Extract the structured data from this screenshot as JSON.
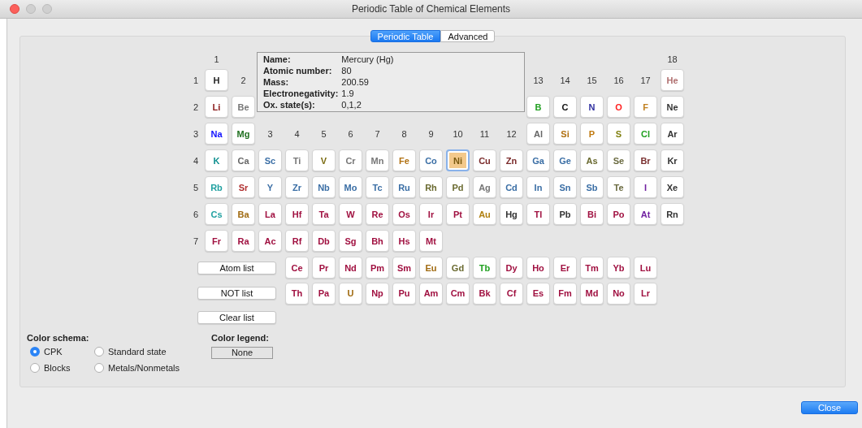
{
  "window": {
    "title": "Periodic Table of Chemical Elements"
  },
  "tabs": [
    {
      "label": "Periodic Table",
      "selected": true
    },
    {
      "label": "Advanced",
      "selected": false
    }
  ],
  "group_labels": [
    "1",
    "2",
    "3",
    "4",
    "5",
    "6",
    "7",
    "8",
    "9",
    "10",
    "11",
    "12",
    "13",
    "14",
    "15",
    "16",
    "17",
    "18"
  ],
  "info": [
    {
      "label": "Name:",
      "value": "Mercury (Hg)"
    },
    {
      "label": "Atomic number:",
      "value": "80"
    },
    {
      "label": "Mass:",
      "value": "200.59"
    },
    {
      "label": "Electronegativity:",
      "value": "1.9"
    },
    {
      "label": "Ox. state(s):",
      "value": "0,1,2"
    }
  ],
  "periods": [
    {
      "label": "1",
      "elements": [
        {
          "symbol": "H",
          "color": "#222222",
          "selected": false
        },
        {
          "symbol": "He",
          "color": "#b07070",
          "selected": false
        }
      ]
    },
    {
      "label": "2",
      "elements": [
        {
          "symbol": "Li",
          "color": "#8b1a1a",
          "selected": false
        },
        {
          "symbol": "Be",
          "color": "#777777",
          "selected": false
        },
        {
          "symbol": "B",
          "color": "#22a022",
          "selected": false
        },
        {
          "symbol": "C",
          "color": "#111111",
          "selected": false
        },
        {
          "symbol": "N",
          "color": "#3030a0",
          "selected": false
        },
        {
          "symbol": "O",
          "color": "#ff2020",
          "selected": false
        },
        {
          "symbol": "F",
          "color": "#c08020",
          "selected": false
        },
        {
          "symbol": "Ne",
          "color": "#333333",
          "selected": false
        }
      ]
    },
    {
      "label": "3",
      "elements": [
        {
          "symbol": "Na",
          "color": "#1010ff",
          "selected": false
        },
        {
          "symbol": "Mg",
          "color": "#207020",
          "selected": false
        },
        {
          "symbol": "Al",
          "color": "#666666",
          "selected": false
        },
        {
          "symbol": "Si",
          "color": "#b07010",
          "selected": false
        },
        {
          "symbol": "P",
          "color": "#c07a10",
          "selected": false
        },
        {
          "symbol": "S",
          "color": "#808010",
          "selected": false
        },
        {
          "symbol": "Cl",
          "color": "#20a020",
          "selected": false
        },
        {
          "symbol": "Ar",
          "color": "#333333",
          "selected": false
        }
      ]
    },
    {
      "label": "4",
      "elements": [
        {
          "symbol": "K",
          "color": "#109090",
          "selected": false
        },
        {
          "symbol": "Ca",
          "color": "#666666",
          "selected": false
        },
        {
          "symbol": "Sc",
          "color": "#3a6ea5",
          "selected": false
        },
        {
          "symbol": "Ti",
          "color": "#777777",
          "selected": false
        },
        {
          "symbol": "V",
          "color": "#7a6a10",
          "selected": false
        },
        {
          "symbol": "Cr",
          "color": "#777777",
          "selected": false
        },
        {
          "symbol": "Mn",
          "color": "#777777",
          "selected": false
        },
        {
          "symbol": "Fe",
          "color": "#b07010",
          "selected": false
        },
        {
          "symbol": "Co",
          "color": "#3a6ea5",
          "selected": false
        },
        {
          "symbol": "Ni",
          "color": "#7a5a10",
          "selected": true
        },
        {
          "symbol": "Cu",
          "color": "#7a2a2a",
          "selected": false
        },
        {
          "symbol": "Zn",
          "color": "#7a2a2a",
          "selected": false
        },
        {
          "symbol": "Ga",
          "color": "#3a6ea5",
          "selected": false
        },
        {
          "symbol": "Ge",
          "color": "#3a6ea5",
          "selected": false
        },
        {
          "symbol": "As",
          "color": "#6a6a30",
          "selected": false
        },
        {
          "symbol": "Se",
          "color": "#6a6a40",
          "selected": false
        },
        {
          "symbol": "Br",
          "color": "#7a3030",
          "selected": false
        },
        {
          "symbol": "Kr",
          "color": "#333333",
          "selected": false
        }
      ]
    },
    {
      "label": "5",
      "elements": [
        {
          "symbol": "Rb",
          "color": "#20a0a0",
          "selected": false
        },
        {
          "symbol": "Sr",
          "color": "#b03030",
          "selected": false
        },
        {
          "symbol": "Y",
          "color": "#3a6ea5",
          "selected": false
        },
        {
          "symbol": "Zr",
          "color": "#3a6ea5",
          "selected": false
        },
        {
          "symbol": "Nb",
          "color": "#3a6ea5",
          "selected": false
        },
        {
          "symbol": "Mo",
          "color": "#3a6ea5",
          "selected": false
        },
        {
          "symbol": "Tc",
          "color": "#3a6ea5",
          "selected": false
        },
        {
          "symbol": "Ru",
          "color": "#3a6ea5",
          "selected": false
        },
        {
          "symbol": "Rh",
          "color": "#6a6a30",
          "selected": false
        },
        {
          "symbol": "Pd",
          "color": "#6a6a30",
          "selected": false
        },
        {
          "symbol": "Ag",
          "color": "#777777",
          "selected": false
        },
        {
          "symbol": "Cd",
          "color": "#3a6ea5",
          "selected": false
        },
        {
          "symbol": "In",
          "color": "#3a6ea5",
          "selected": false
        },
        {
          "symbol": "Sn",
          "color": "#3a6ea5",
          "selected": false
        },
        {
          "symbol": "Sb",
          "color": "#3a6ea5",
          "selected": false
        },
        {
          "symbol": "Te",
          "color": "#6a6a40",
          "selected": false
        },
        {
          "symbol": "I",
          "color": "#7020a0",
          "selected": false
        },
        {
          "symbol": "Xe",
          "color": "#333333",
          "selected": false
        }
      ]
    },
    {
      "label": "6",
      "elements": [
        {
          "symbol": "Cs",
          "color": "#20a0a0",
          "selected": false
        },
        {
          "symbol": "Ba",
          "color": "#a06a10",
          "selected": false
        },
        {
          "symbol": "La",
          "color": "#a01040",
          "selected": false
        },
        {
          "symbol": "Hf",
          "color": "#a01040",
          "selected": false
        },
        {
          "symbol": "Ta",
          "color": "#a01040",
          "selected": false
        },
        {
          "symbol": "W",
          "color": "#a01040",
          "selected": false
        },
        {
          "symbol": "Re",
          "color": "#a01040",
          "selected": false
        },
        {
          "symbol": "Os",
          "color": "#a01040",
          "selected": false
        },
        {
          "symbol": "Ir",
          "color": "#a01040",
          "selected": false
        },
        {
          "symbol": "Pt",
          "color": "#a01040",
          "selected": false
        },
        {
          "symbol": "Au",
          "color": "#b08010",
          "selected": false
        },
        {
          "symbol": "Hg",
          "color": "#333333",
          "selected": false
        },
        {
          "symbol": "Tl",
          "color": "#a01040",
          "selected": false
        },
        {
          "symbol": "Pb",
          "color": "#333333",
          "selected": false
        },
        {
          "symbol": "Bi",
          "color": "#a01040",
          "selected": false
        },
        {
          "symbol": "Po",
          "color": "#a01040",
          "selected": false
        },
        {
          "symbol": "At",
          "color": "#7020a0",
          "selected": false
        },
        {
          "symbol": "Rn",
          "color": "#333333",
          "selected": false
        }
      ]
    },
    {
      "label": "7",
      "elements": [
        {
          "symbol": "Fr",
          "color": "#a01040",
          "selected": false
        },
        {
          "symbol": "Ra",
          "color": "#a01040",
          "selected": false
        },
        {
          "symbol": "Ac",
          "color": "#a01040",
          "selected": false
        },
        {
          "symbol": "Rf",
          "color": "#a01040",
          "selected": false
        },
        {
          "symbol": "Db",
          "color": "#a01040",
          "selected": false
        },
        {
          "symbol": "Sg",
          "color": "#a01040",
          "selected": false
        },
        {
          "symbol": "Bh",
          "color": "#a01040",
          "selected": false
        },
        {
          "symbol": "Hs",
          "color": "#a01040",
          "selected": false
        },
        {
          "symbol": "Mt",
          "color": "#a01040",
          "selected": false
        }
      ]
    }
  ],
  "lanthanides": [
    {
      "symbol": "Ce",
      "color": "#a01040",
      "selected": false
    },
    {
      "symbol": "Pr",
      "color": "#a01040",
      "selected": false
    },
    {
      "symbol": "Nd",
      "color": "#a01040",
      "selected": false
    },
    {
      "symbol": "Pm",
      "color": "#a01040",
      "selected": false
    },
    {
      "symbol": "Sm",
      "color": "#a01040",
      "selected": false
    },
    {
      "symbol": "Eu",
      "color": "#a06a10",
      "selected": false
    },
    {
      "symbol": "Gd",
      "color": "#6a6a30",
      "selected": false
    },
    {
      "symbol": "Tb",
      "color": "#20a020",
      "selected": false
    },
    {
      "symbol": "Dy",
      "color": "#a01040",
      "selected": false
    },
    {
      "symbol": "Ho",
      "color": "#a01040",
      "selected": false
    },
    {
      "symbol": "Er",
      "color": "#a01040",
      "selected": false
    },
    {
      "symbol": "Tm",
      "color": "#a01040",
      "selected": false
    },
    {
      "symbol": "Yb",
      "color": "#a01040",
      "selected": false
    },
    {
      "symbol": "Lu",
      "color": "#a01040",
      "selected": false
    }
  ],
  "actinides": [
    {
      "symbol": "Th",
      "color": "#a01040",
      "selected": false
    },
    {
      "symbol": "Pa",
      "color": "#a01040",
      "selected": false
    },
    {
      "symbol": "U",
      "color": "#a06a10",
      "selected": false
    },
    {
      "symbol": "Np",
      "color": "#a01040",
      "selected": false
    },
    {
      "symbol": "Pu",
      "color": "#a01040",
      "selected": false
    },
    {
      "symbol": "Am",
      "color": "#a01040",
      "selected": false
    },
    {
      "symbol": "Cm",
      "color": "#a01040",
      "selected": false
    },
    {
      "symbol": "Bk",
      "color": "#a01040",
      "selected": false
    },
    {
      "symbol": "Cf",
      "color": "#a01040",
      "selected": false
    },
    {
      "symbol": "Es",
      "color": "#a01040",
      "selected": false
    },
    {
      "symbol": "Fm",
      "color": "#a01040",
      "selected": false
    },
    {
      "symbol": "Md",
      "color": "#a01040",
      "selected": false
    },
    {
      "symbol": "No",
      "color": "#a01040",
      "selected": false
    },
    {
      "symbol": "Lr",
      "color": "#a01040",
      "selected": false
    }
  ],
  "list_buttons": [
    "Atom list",
    "NOT list",
    "Clear list"
  ],
  "color_schema": {
    "title": "Color schema:",
    "options": [
      {
        "label": "CPK",
        "selected": true
      },
      {
        "label": "Standard state",
        "selected": false
      },
      {
        "label": "Blocks",
        "selected": false
      },
      {
        "label": "Metals/Nonmetals",
        "selected": false
      }
    ]
  },
  "color_legend": {
    "title": "Color legend:",
    "value": "None"
  },
  "close_button": "Close"
}
